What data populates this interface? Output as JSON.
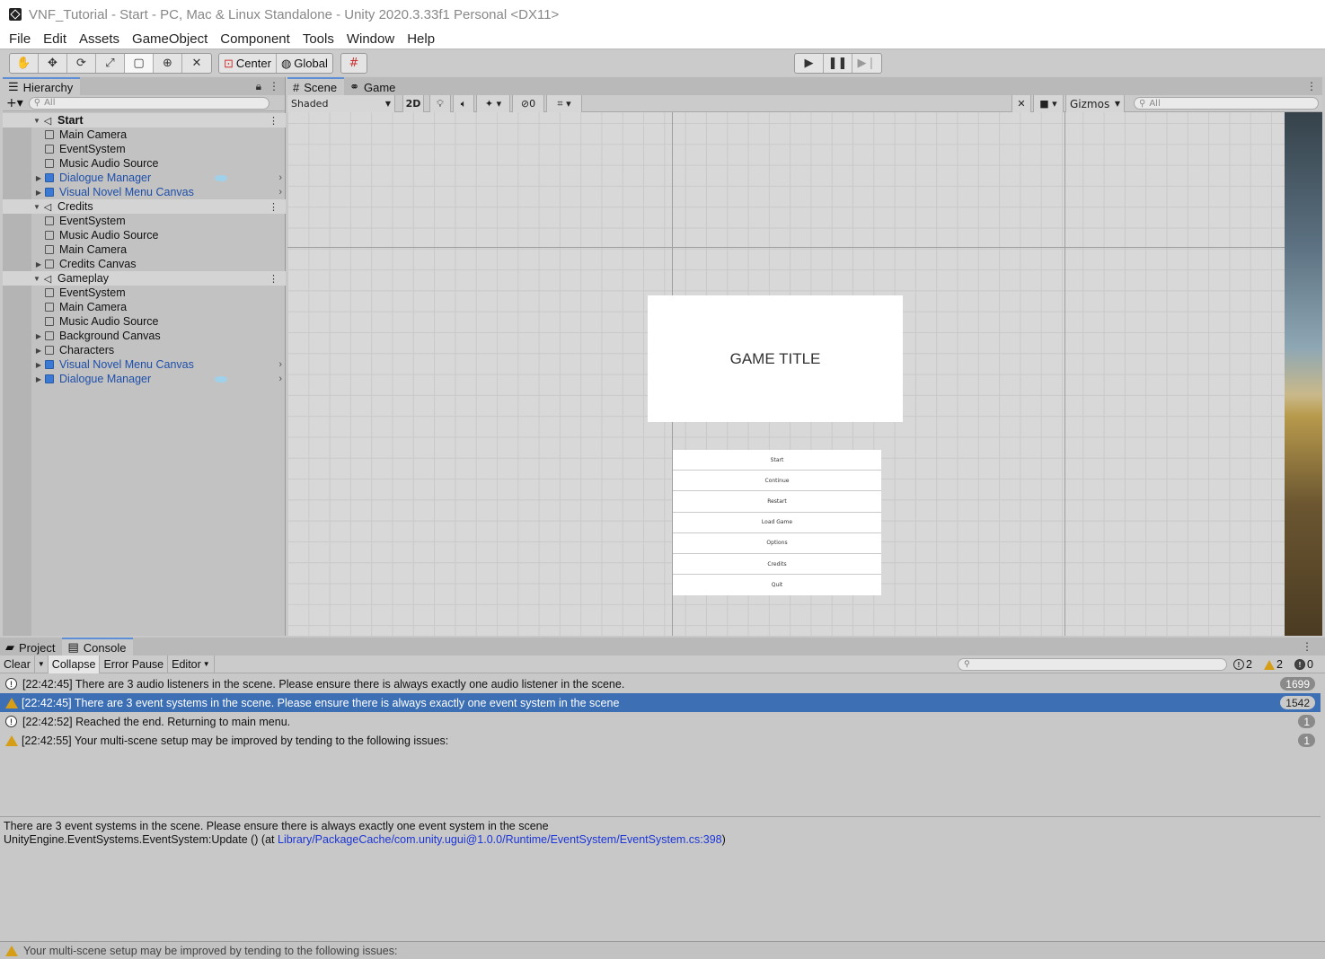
{
  "window": {
    "title": "VNF_Tutorial - Start - PC, Mac & Linux Standalone - Unity 2020.3.33f1 Personal <DX11>"
  },
  "menu": [
    "File",
    "Edit",
    "Assets",
    "GameObject",
    "Component",
    "Tools",
    "Window",
    "Help"
  ],
  "toolbar": {
    "pivot": "Center",
    "space": "Global"
  },
  "hierarchy": {
    "tab": "Hierarchy",
    "search_placeholder": "All",
    "scenes": [
      {
        "name": "Start",
        "bold": true,
        "children": [
          {
            "name": "Main Camera",
            "prefab": false,
            "expandable": false
          },
          {
            "name": "EventSystem",
            "prefab": false,
            "expandable": false
          },
          {
            "name": "Music Audio Source",
            "prefab": false,
            "expandable": false
          },
          {
            "name": "Dialogue Manager",
            "prefab": true,
            "expandable": true,
            "eye": true
          },
          {
            "name": "Visual Novel Menu Canvas",
            "prefab": true,
            "expandable": true
          }
        ]
      },
      {
        "name": "Credits",
        "bold": false,
        "children": [
          {
            "name": "EventSystem",
            "prefab": false,
            "expandable": false
          },
          {
            "name": "Music Audio Source",
            "prefab": false,
            "expandable": false
          },
          {
            "name": "Main Camera",
            "prefab": false,
            "expandable": false
          },
          {
            "name": "Credits Canvas",
            "prefab": false,
            "expandable": true
          }
        ]
      },
      {
        "name": "Gameplay",
        "bold": false,
        "children": [
          {
            "name": "EventSystem",
            "prefab": false,
            "expandable": false
          },
          {
            "name": "Main Camera",
            "prefab": false,
            "expandable": false
          },
          {
            "name": "Music Audio Source",
            "prefab": false,
            "expandable": false
          },
          {
            "name": "Background Canvas",
            "prefab": false,
            "expandable": true
          },
          {
            "name": "Characters",
            "prefab": false,
            "expandable": true
          },
          {
            "name": "Visual Novel Menu Canvas",
            "prefab": true,
            "expandable": true
          },
          {
            "name": "Dialogue Manager",
            "prefab": true,
            "expandable": true,
            "eye": true
          }
        ]
      }
    ]
  },
  "scene": {
    "tabs": [
      "Scene",
      "Game"
    ],
    "shading": "Shaded",
    "mode_2d": "2D",
    "hidden_count": "0",
    "gizmos": "Gizmos",
    "search_placeholder": "All",
    "game_title": "GAME TITLE",
    "menu_buttons": [
      "Start",
      "Continue",
      "Restart",
      "Load Game",
      "Options",
      "Credits",
      "Quit"
    ]
  },
  "console": {
    "tabs": [
      "Project",
      "Console"
    ],
    "buttons": {
      "clear": "Clear",
      "collapse": "Collapse",
      "error_pause": "Error Pause",
      "editor": "Editor"
    },
    "counts": {
      "info": "2",
      "warnings": "2",
      "errors": "0"
    },
    "logs": [
      {
        "type": "info",
        "text": "[22:42:45] There are 3 audio listeners in the scene. Please ensure there is always exactly one audio listener in the scene.",
        "count": "1699",
        "selected": false
      },
      {
        "type": "warning",
        "text": "[22:42:45] There are 3 event systems in the scene. Please ensure there is always exactly one event system in the scene",
        "count": "1542",
        "selected": true
      },
      {
        "type": "info",
        "text": "[22:42:52] Reached the end. Returning to main menu.",
        "count": "1",
        "selected": false
      },
      {
        "type": "warning",
        "text": "[22:42:55] Your multi-scene setup may be improved by tending to the following issues:",
        "count": "1",
        "selected": false
      }
    ],
    "detail": {
      "line1": "There are 3 event systems in the scene. Please ensure there is always exactly one event system in the scene",
      "line2_prefix": "UnityEngine.EventSystems.EventSystem:Update () (at ",
      "line2_link": "Library/PackageCache/com.unity.ugui@1.0.0/Runtime/EventSystem/EventSystem.cs:398",
      "line2_suffix": ")"
    }
  },
  "status": {
    "text": "Your multi-scene setup may be improved by tending to the following issues:"
  }
}
